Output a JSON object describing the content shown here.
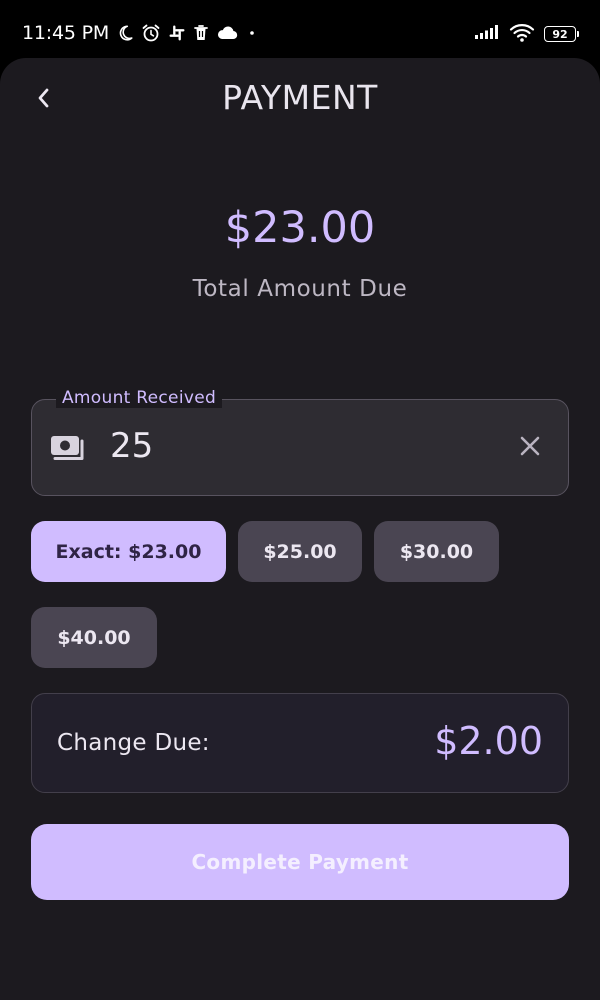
{
  "status_bar": {
    "time": "11:45 PM",
    "battery": "92"
  },
  "header": {
    "title": "PAYMENT"
  },
  "summary": {
    "total_amount": "$23.00",
    "total_label": "Total Amount Due"
  },
  "amount_field": {
    "label": "Amount Received",
    "value": "25"
  },
  "quick_amounts": [
    {
      "label": "Exact: $23.00",
      "selected": true
    },
    {
      "label": "$25.00",
      "selected": false
    },
    {
      "label": "$30.00",
      "selected": false
    },
    {
      "label": "$40.00",
      "selected": false
    }
  ],
  "change": {
    "label": "Change Due:",
    "value": "$2.00"
  },
  "actions": {
    "complete_label": "Complete Payment"
  },
  "colors": {
    "accent": "#d0bcff",
    "surface": "#1c1a1f",
    "chip": "#4a4552",
    "field": "#2e2c32"
  },
  "icons": {
    "back": "chevron-left-icon",
    "money": "money-icon",
    "clear": "close-icon"
  }
}
